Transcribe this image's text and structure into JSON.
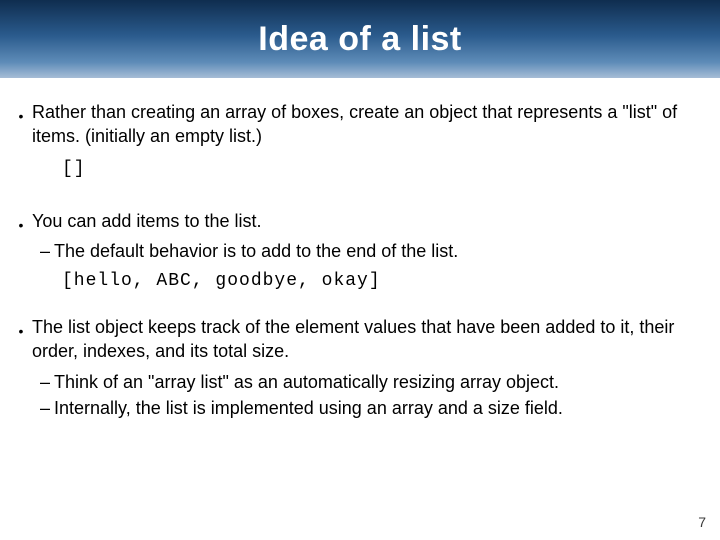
{
  "header": {
    "title": "Idea of a list"
  },
  "bullets": {
    "b1": "Rather than creating an array of boxes, create an object that represents a \"list\" of items.  (initially an empty list.)",
    "code1": "[]",
    "b2": "You can add items to the list.",
    "b2_sub1": "The default behavior is to add to the end of the list.",
    "code2": "[hello, ABC, goodbye, okay]",
    "b3": "The list object keeps track of the element values that have been added to it, their order, indexes, and its total size.",
    "b3_sub1": "Think of an \"array list\" as an automatically resizing array object.",
    "b3_sub2": "Internally, the list is implemented using an array and a size field."
  },
  "dash": "–",
  "page_number": "7"
}
